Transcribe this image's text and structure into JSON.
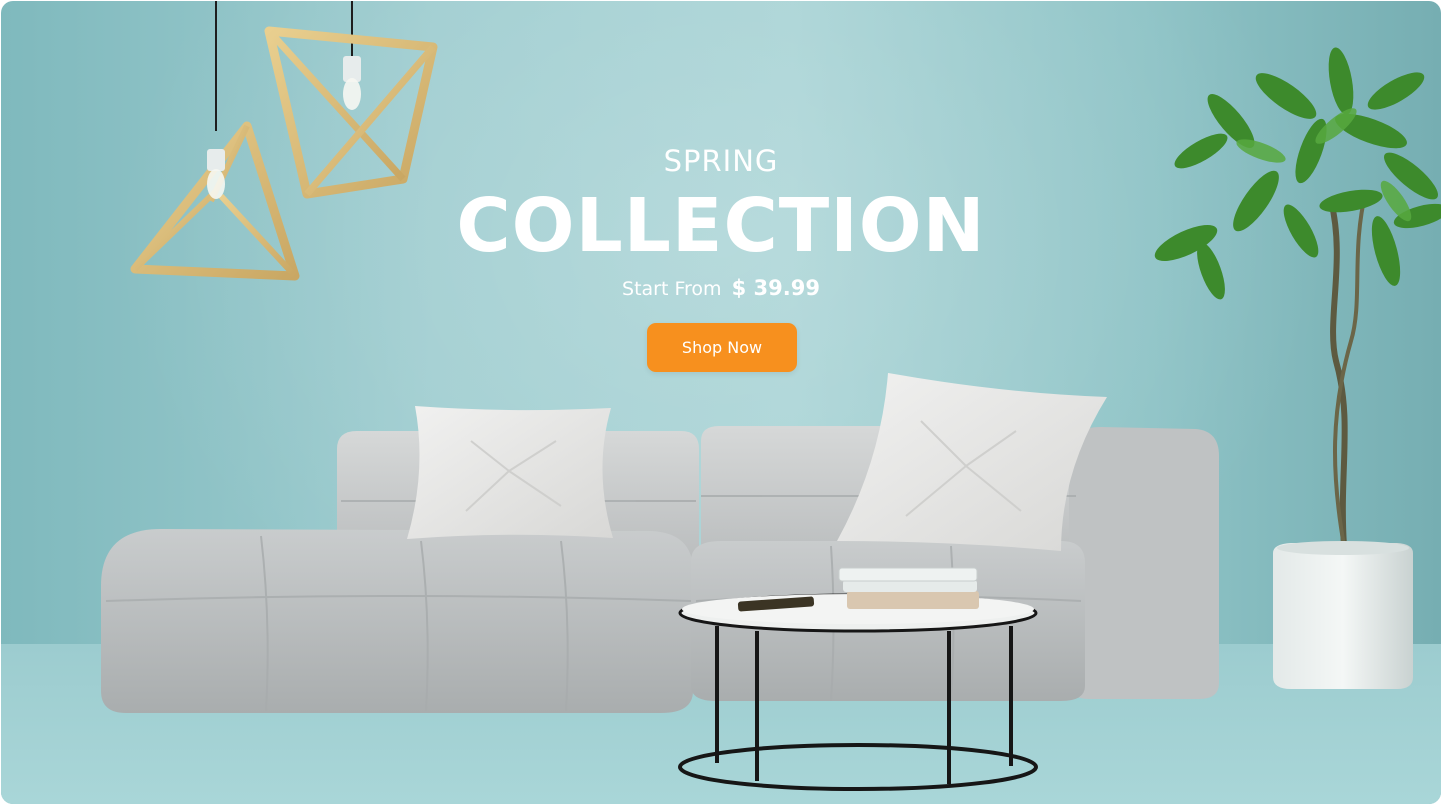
{
  "hero": {
    "eyebrow": "SPRING",
    "headline": "COLLECTION",
    "price_prefix": "Start From",
    "price_value": "$ 39.99",
    "cta_label": "Shop Now"
  },
  "colors": {
    "accent": "#f7901e",
    "wall": "#a8d3d5",
    "text": "#ffffff"
  },
  "imagery": {
    "lamps": "pendant-lamp-icon",
    "sofa": "sofa-icon",
    "plant": "potted-plant-icon",
    "table": "coffee-table-icon"
  }
}
